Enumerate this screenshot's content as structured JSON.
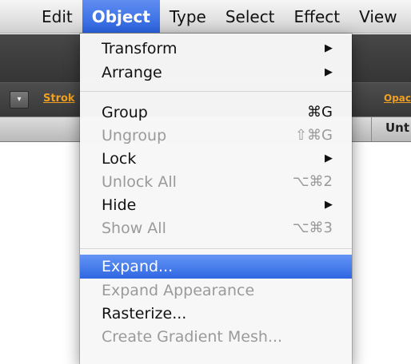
{
  "menubar": {
    "items": [
      "Edit",
      "Object",
      "Type",
      "Select",
      "Effect",
      "View"
    ]
  },
  "controlbar": {
    "stroke_label": "Strok",
    "opacity_label": "Opacity:",
    "dropdown_glyph": "▾"
  },
  "tabbar": {
    "doc_tab_label": "Unt"
  },
  "menu": {
    "arrow_glyph": "▶",
    "items": [
      {
        "label": "Transform",
        "shortcut": "",
        "submenu": true,
        "disabled": false
      },
      {
        "label": "Arrange",
        "shortcut": "",
        "submenu": true,
        "disabled": false
      },
      {
        "label": "Group",
        "shortcut": "⌘G",
        "submenu": false,
        "disabled": false
      },
      {
        "label": "Ungroup",
        "shortcut": "⇧⌘G",
        "submenu": false,
        "disabled": true
      },
      {
        "label": "Lock",
        "shortcut": "",
        "submenu": true,
        "disabled": false
      },
      {
        "label": "Unlock All",
        "shortcut": "⌥⌘2",
        "submenu": false,
        "disabled": true
      },
      {
        "label": "Hide",
        "shortcut": "",
        "submenu": true,
        "disabled": false
      },
      {
        "label": "Show All",
        "shortcut": "⌥⌘3",
        "submenu": false,
        "disabled": true
      },
      {
        "label": "Expand...",
        "shortcut": "",
        "submenu": false,
        "disabled": false,
        "highlighted": true
      },
      {
        "label": "Expand Appearance",
        "shortcut": "",
        "submenu": false,
        "disabled": true
      },
      {
        "label": "Rasterize...",
        "shortcut": "",
        "submenu": false,
        "disabled": false
      },
      {
        "label": "Create Gradient Mesh...",
        "shortcut": "",
        "submenu": false,
        "disabled": true
      }
    ]
  },
  "colors": {
    "highlight": "#2f67e2",
    "disabled_text": "#9a9a9a",
    "link_orange": "#f0a020"
  }
}
